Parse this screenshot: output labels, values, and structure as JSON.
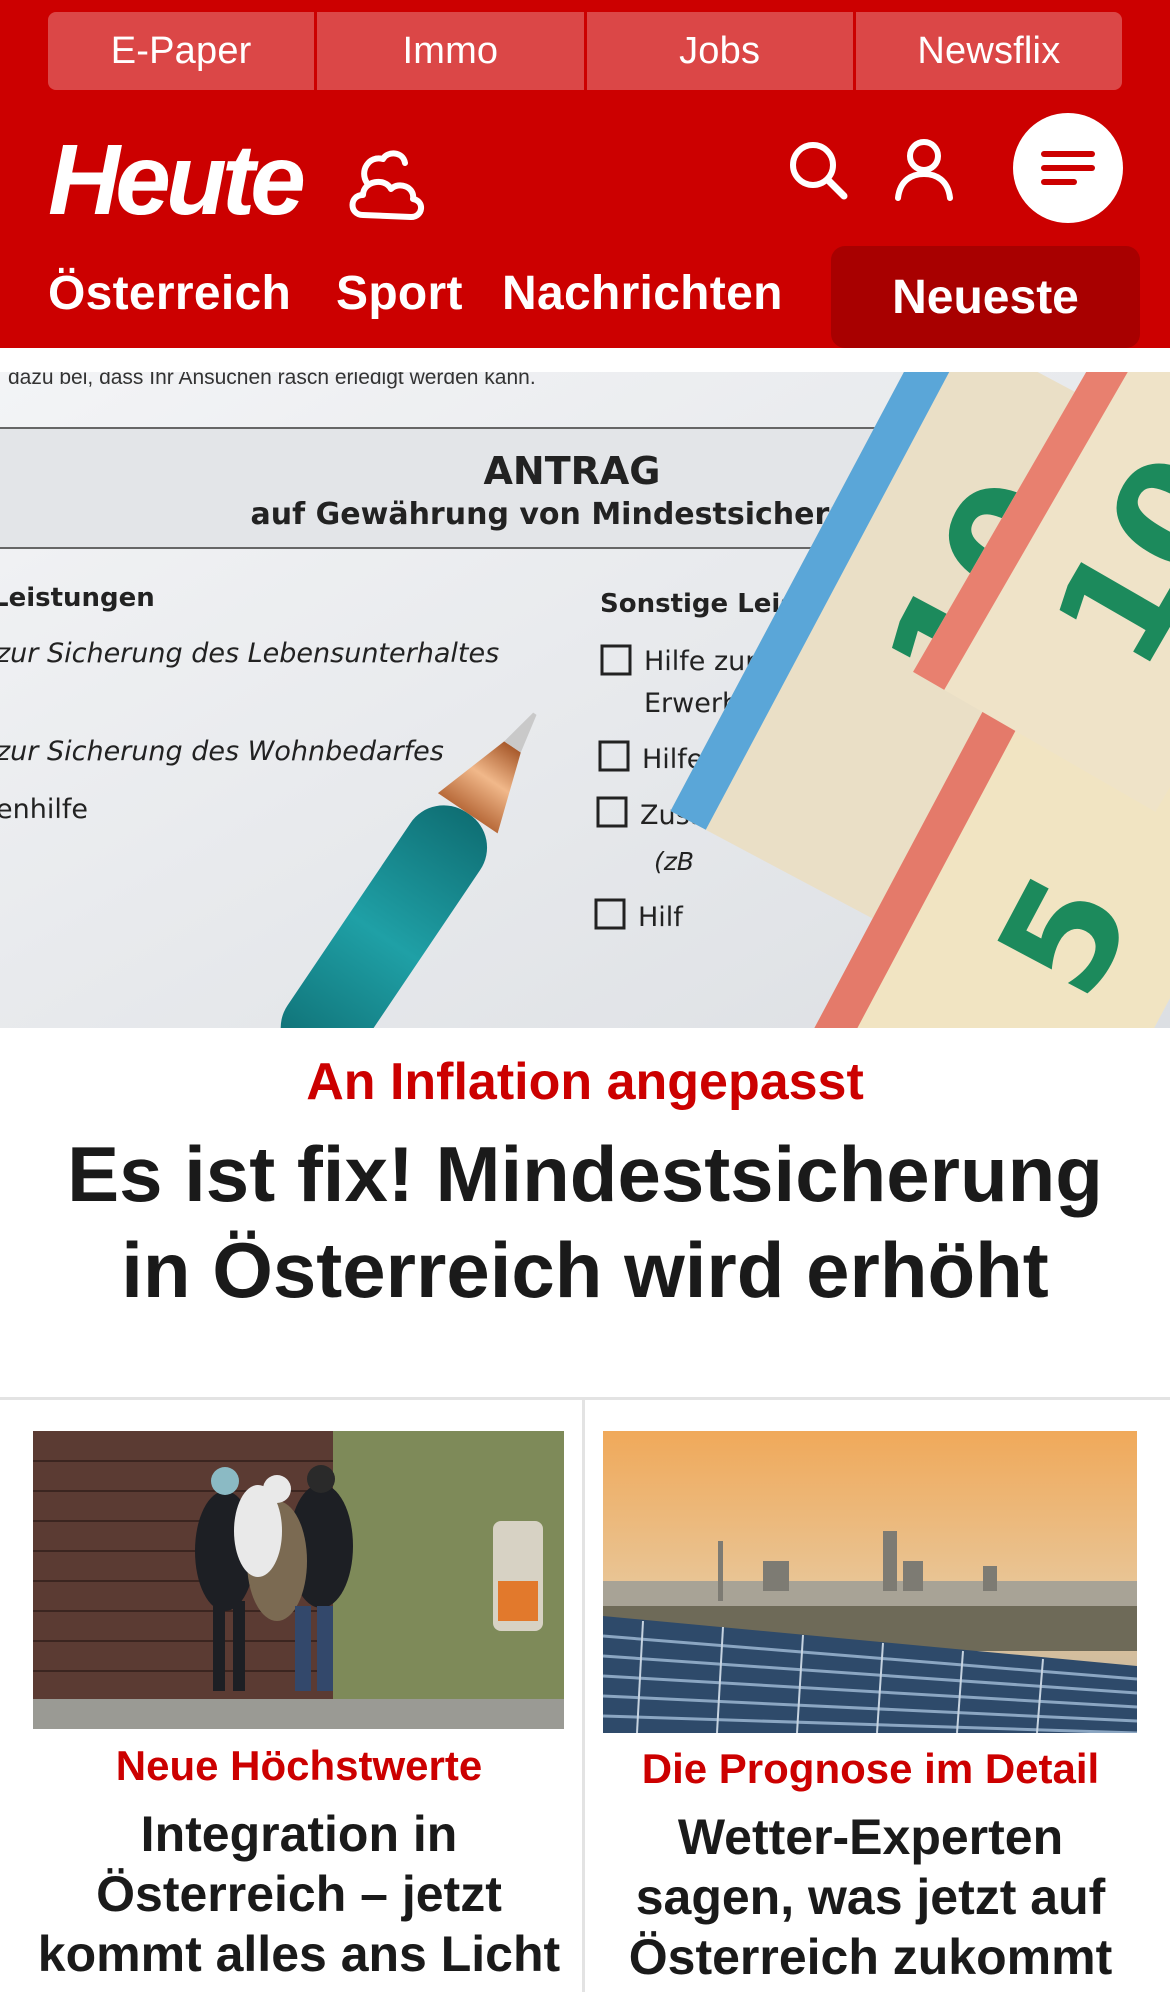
{
  "colors": {
    "brand_red": "#cc0000",
    "dark_red": "#a80000",
    "top_tab": "#db4747"
  },
  "top_nav": [
    {
      "label": "E-Paper"
    },
    {
      "label": "Immo"
    },
    {
      "label": "Jobs"
    },
    {
      "label": "Newsflix"
    }
  ],
  "header": {
    "logo": "Heute",
    "icons": [
      "weather-cloud-sun-icon",
      "search-icon",
      "user-icon",
      "menu-icon"
    ]
  },
  "section_nav": {
    "items": [
      {
        "label": "Österreich"
      },
      {
        "label": "Sport"
      },
      {
        "label": "Nachrichten"
      }
    ],
    "active": "Neueste"
  },
  "hero": {
    "image": {
      "header_line": "dazu bei, dass Ihr Ansuchen rasch erledigt werden kann.",
      "form_title": "ANTRAG",
      "form_subtitle": "auf Gewährung von Mindestsicherung",
      "left_column": [
        "Leistungen",
        "zur Sicherung des Lebensunterhaltes",
        "zur Sicherung des Wohnbedarfes",
        "enhilfe"
      ],
      "right_column": [
        "Sonstige Leist",
        "Hilfe zur Er",
        "Erwerbsb",
        "Hilfe zur",
        "Zusatz",
        "(zB",
        "Hilf"
      ],
      "banknotes": [
        "10",
        "5",
        "10"
      ]
    },
    "kicker": "An Inflation angepasst",
    "title": "Es ist fix! Mindestsicherung in Österreich wird erhöht"
  },
  "cards": [
    {
      "kicker": "Neue Höchstwerte",
      "title": "Integration in Österreich – jetzt kommt alles ans Licht"
    },
    {
      "kicker": "Die Prognose im Detail",
      "title": "Wetter-Experten sagen, was jetzt auf Österreich zukommt"
    }
  ]
}
